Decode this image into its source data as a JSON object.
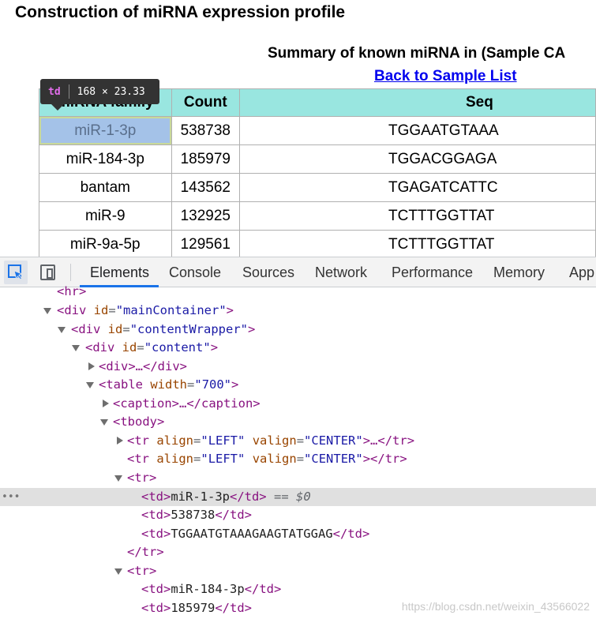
{
  "page": {
    "heading": "Construction of miRNA expression profile",
    "caption": "Summary of known miRNA in (Sample CA",
    "back_link": "Back to Sample List",
    "table": {
      "headers": [
        "miRNA family",
        "Count",
        "Seq"
      ],
      "rows": [
        {
          "family": "miR-1-3p",
          "count": "538738",
          "seq": "TGGAATGTAAA"
        },
        {
          "family": "miR-184-3p",
          "count": "185979",
          "seq": "TGGACGGAGA"
        },
        {
          "family": "bantam",
          "count": "143562",
          "seq": "TGAGATCATTC"
        },
        {
          "family": "miR-9",
          "count": "132925",
          "seq": "TCTTTGGTTAT"
        },
        {
          "family": "miR-9a-5p",
          "count": "129561",
          "seq": "TCTTTGGTTAT"
        }
      ]
    }
  },
  "tooltip": {
    "tag": "td",
    "dims": "168 × 23.33"
  },
  "devtools": {
    "tabs": [
      "Elements",
      "Console",
      "Sources",
      "Network",
      "Performance",
      "Memory",
      "App"
    ],
    "active_tab": "Elements",
    "dom": {
      "hr": "<hr>",
      "main_open": "<div",
      "main_attr": "id",
      "main_val": "\"mainContainer\"",
      "wrap_val": "\"contentWrapper\"",
      "content_val": "\"content\"",
      "div_collapsed": "<div>…</div>",
      "table_open": "<table",
      "table_attr": "width",
      "table_val": "\"700\"",
      "caption_collapsed": "<caption>…</caption>",
      "tbody": "<tbody>",
      "tr_open": "<tr",
      "tr_align_attr": "align",
      "tr_align_val": "\"LEFT\"",
      "tr_valign_attr": "valign",
      "tr_valign_val": "\"CENTER\"",
      "tr_collapsed_tail": ">…</tr>",
      "tr_empty_tail": "></tr>",
      "tr": "<tr>",
      "tr_close": "</tr>",
      "td_open": "<td>",
      "td_close": "</td>",
      "td1": "miR-1-3p",
      "td2": "538738",
      "td3": "TGGAATGTAAAGAAGTATGGAG",
      "td4": "miR-184-3p",
      "td5": "185979",
      "selected_marker": "== $0",
      "close_angle": ">",
      "ellipsis": "•••"
    }
  },
  "watermark": "https://blog.csdn.net/weixin_43566022"
}
